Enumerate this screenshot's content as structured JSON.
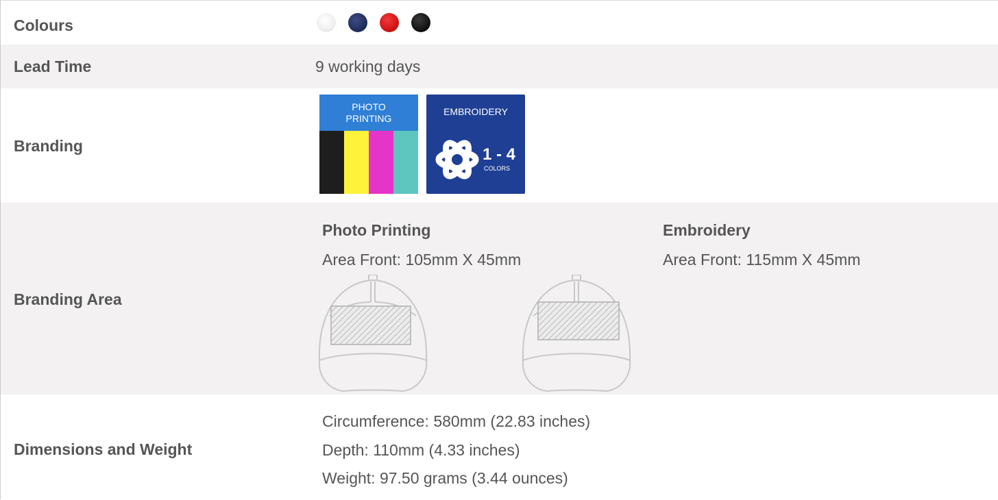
{
  "rows": {
    "colours": {
      "label": "Colours",
      "swatches": [
        {
          "name": "white",
          "color": "#f2f2f2"
        },
        {
          "name": "navy",
          "color": "#22305e"
        },
        {
          "name": "red",
          "color": "#d21414"
        },
        {
          "name": "black",
          "color": "#141414"
        }
      ]
    },
    "lead_time": {
      "label": "Lead Time",
      "value": "9 working days"
    },
    "branding": {
      "label": "Branding",
      "photo_badge": {
        "line1": "PHOTO",
        "line2": "PRINTING"
      },
      "embroidery_badge": {
        "title": "EMBROIDERY",
        "range": "1 - 4",
        "unit": "COLORS"
      }
    },
    "branding_area": {
      "label": "Branding Area",
      "methods": [
        {
          "name": "Photo Printing",
          "area": "Area Front: 105mm X 45mm"
        },
        {
          "name": "Embroidery",
          "area": "Area Front: 115mm X 45mm"
        }
      ]
    },
    "dimensions": {
      "label": "Dimensions and Weight",
      "lines": [
        "Circumference: 580mm (22.83 inches)",
        "Depth: 110mm (4.33 inches)",
        "Weight: 97.50 grams (3.44 ounces)"
      ]
    }
  },
  "colors": {
    "row_alt_bg": "#f3f1f1",
    "text": "#555555",
    "photo_top": "#2f7fd6",
    "cmyk": [
      "#1e1e1e",
      "#fff23a",
      "#e535c8",
      "#5ec6bf"
    ],
    "embroidery_bg": "#1f3f94"
  }
}
